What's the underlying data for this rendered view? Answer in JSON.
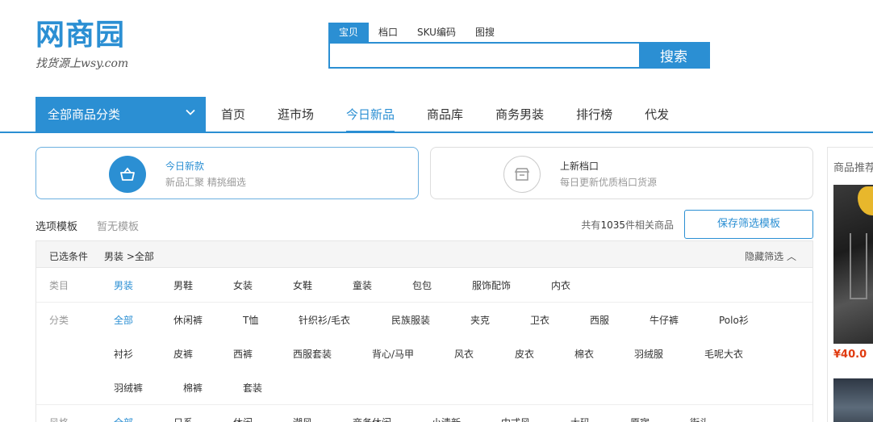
{
  "logo": {
    "main": "网商园",
    "sub": "找货源上wsy.com"
  },
  "search": {
    "tabs": [
      "宝贝",
      "档口",
      "SKU编码",
      "图搜"
    ],
    "placeholder": "",
    "button": "搜索"
  },
  "nav": {
    "all_categories": "全部商品分类",
    "links": [
      "首页",
      "逛市场",
      "今日新品",
      "商品库",
      "商务男装",
      "排行榜",
      "代发"
    ],
    "active": "今日新品"
  },
  "cards": [
    {
      "title": "今日新款",
      "subtitle": "新品汇聚 精挑细选",
      "icon": "basket-icon"
    },
    {
      "title": "上新档口",
      "subtitle": "每日更新优质档口货源",
      "icon": "store-icon"
    }
  ],
  "sidebar": {
    "title": "商品推荐",
    "price": "¥40.0"
  },
  "filter_header": {
    "template_label": "选项模板",
    "template_value": "暂无模板",
    "count_prefix": "共有",
    "count": "1035",
    "count_suffix": "件相关商品",
    "save_button": "保存筛选模板"
  },
  "filter": {
    "selected_label": "已选条件",
    "selected_value": "男装 >全部",
    "hide_label": "隐藏筛选 ︿",
    "rows": [
      {
        "label": "类目",
        "options": [
          "男装",
          "男鞋",
          "女装",
          "女鞋",
          "童装",
          "包包",
          "服饰配饰",
          "内衣"
        ]
      },
      {
        "label": "分类",
        "options": [
          "全部",
          "休闲裤",
          "T恤",
          "针织衫/毛衣",
          "民族服装",
          "夹克",
          "卫衣",
          "西服",
          "牛仔裤",
          "Polo衫",
          "衬衫",
          "皮裤",
          "西裤",
          "西服套装",
          "背心/马甲",
          "风衣",
          "皮衣",
          "棉衣",
          "羽绒服",
          "毛呢大衣",
          "羽绒裤",
          "棉裤",
          "套装"
        ]
      },
      {
        "label": "风格",
        "options": [
          "全部",
          "日系",
          "休闲",
          "潮风",
          "商务休闲",
          "小清新",
          "中式风",
          "大码",
          "原宿",
          "街头"
        ]
      }
    ]
  }
}
